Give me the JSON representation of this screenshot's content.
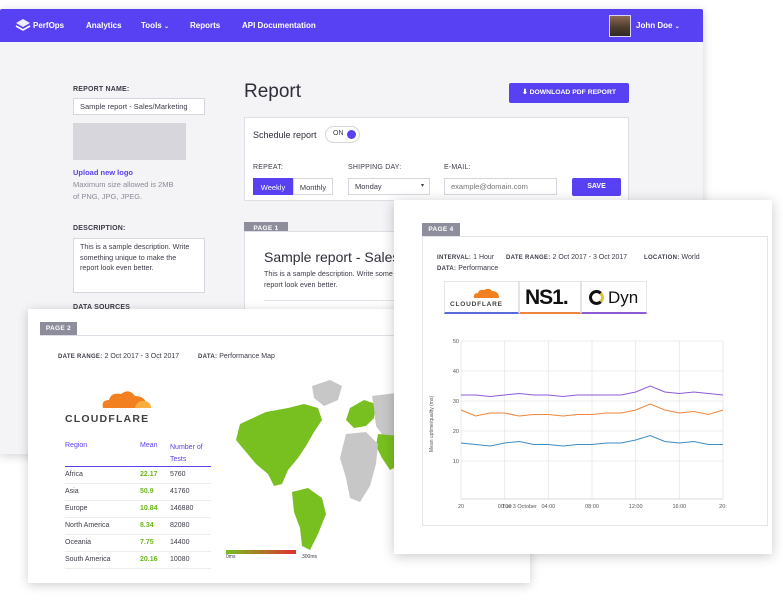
{
  "nav": {
    "brand": "PerfOps",
    "items": [
      "Analytics",
      "Tools",
      "Reports",
      "API Documentation"
    ],
    "user_name": "John Doe",
    "accent": "#5841f2"
  },
  "sidebar": {
    "report_name_label": "REPORT NAME:",
    "report_name_value": "Sample report - Sales/Marketing",
    "upload_logo": "Upload new logo",
    "upload_hint_1": "Maximum size allowed is 2MB",
    "upload_hint_2": "of PNG, JPG, JPEG.",
    "description_label": "DESCRIPTION:",
    "description_lines": [
      "This is a sample description. Write",
      "something unique to make the",
      "report look even better."
    ],
    "data_sources_label": "DATA SOURCES"
  },
  "report": {
    "title": "Report",
    "download_button": "DOWNLOAD PDF REPORT",
    "schedule_label": "Schedule report",
    "toggle_label": "ON",
    "repeat_label": "REPEAT:",
    "repeat_options": [
      "Weekly",
      "Monthly"
    ],
    "shipping_day_label": "SHIPPING DAY:",
    "shipping_day_value": "Monday",
    "email_label": "E-MAIL:",
    "email_placeholder": "example@domain.com",
    "save_button": "SAVE"
  },
  "page1": {
    "tab": "PAGE 1",
    "title": "Sample report - Sales",
    "desc_lines": [
      "This is a sample description. Write some",
      "report look even better."
    ]
  },
  "page2": {
    "tab": "PAGE 2",
    "date_range_label": "DATE RANGE:",
    "date_range_value": "2 Oct 2017 - 3 Oct 2017",
    "data_label": "DATA:",
    "data_value": "Performance Map",
    "provider_logo": "CLOUDFLARE",
    "table_headers": [
      "Region",
      "Mean",
      "Number of",
      "Tests"
    ],
    "rows": [
      {
        "region": "Africa",
        "mean": "22.17",
        "tests": "5760"
      },
      {
        "region": "Asia",
        "mean": "50.9",
        "tests": "41760"
      },
      {
        "region": "Europe",
        "mean": "10.84",
        "tests": "146880"
      },
      {
        "region": "North America",
        "mean": "8.34",
        "tests": "82080"
      },
      {
        "region": "Oceania",
        "mean": "7.75",
        "tests": "14400"
      },
      {
        "region": "South America",
        "mean": "20.16",
        "tests": "10080"
      }
    ],
    "legend_min": "0ms",
    "legend_max": "300ms"
  },
  "page4": {
    "tab": "PAGE 4",
    "interval_label": "INTERVAL:",
    "interval_value": "1 Hour",
    "date_range_label": "DATE RANGE:",
    "date_range_value": "2 Oct 2017 - 3 Oct 2017",
    "location_label": "LOCATION:",
    "location_value": "World",
    "data_label": "DATA:",
    "data_value": "Performance",
    "logos": [
      "CLOUDFLARE",
      "NS1.",
      "Dyn"
    ],
    "y_axis_label": "Mean uptime/quality (ms)",
    "date_caption": "Tue 3 October"
  },
  "chart_data": {
    "type": "line",
    "ylim": [
      0,
      50
    ],
    "yticks": [
      "10",
      "20",
      "30",
      "40",
      "50"
    ],
    "xticks": [
      "20",
      "00:00",
      "04:00",
      "08:00",
      "12:00",
      "16:00",
      "20:"
    ],
    "series": [
      {
        "color": "#8e5bd6",
        "values": [
          32,
          32,
          31.5,
          32,
          32.5,
          32,
          32,
          31.5,
          32,
          32,
          32,
          32,
          33,
          35,
          33,
          32.5,
          33,
          32.5,
          32
        ]
      },
      {
        "color": "#f0843c",
        "values": [
          27,
          25,
          26,
          26,
          25,
          25.5,
          25.5,
          25,
          25.5,
          25.5,
          26,
          26,
          27,
          29,
          27,
          26,
          26.5,
          25.5,
          27
        ]
      },
      {
        "color": "#3f8cc4",
        "values": [
          16,
          15.5,
          15,
          16,
          16.5,
          15.5,
          15.5,
          15,
          15.5,
          15.5,
          16,
          16,
          17,
          18.5,
          16.5,
          16,
          16.5,
          15.5,
          15.5
        ]
      }
    ]
  }
}
